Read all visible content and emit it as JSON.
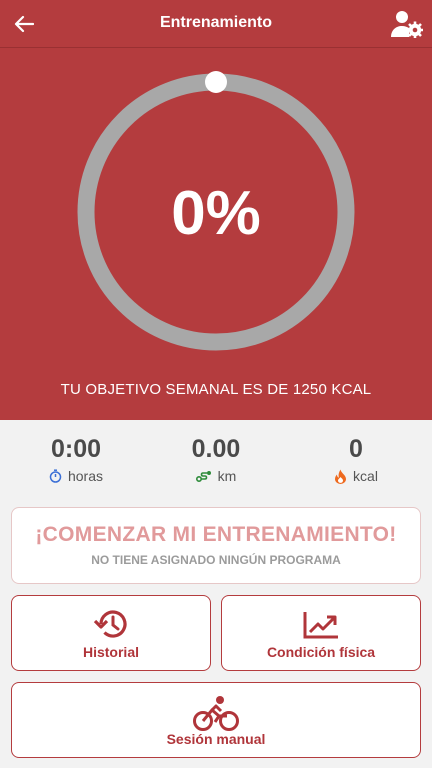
{
  "header": {
    "title": "Entrenamiento"
  },
  "progress": {
    "percent_label": "0%",
    "fraction": 0.0
  },
  "goal_text": "TU OBJETIVO SEMANAL ES DE 1250 KCAL",
  "stats": [
    {
      "value": "0:00",
      "unit": "horas",
      "icon": "stopwatch-icon"
    },
    {
      "value": "0.00",
      "unit": "km",
      "icon": "route-icon"
    },
    {
      "value": "0",
      "unit": "kcal",
      "icon": "flame-icon"
    }
  ],
  "cta": {
    "title": "¡COMENZAR MI ENTRENAMIENTO!",
    "subtitle": "NO TIENE ASIGNADO NINGÚN PROGRAMA"
  },
  "cards": {
    "history": {
      "label": "Historial",
      "icon": "history-icon"
    },
    "fitness": {
      "label": "Condición física",
      "icon": "trend-up-icon"
    },
    "manual": {
      "label": "Sesión manual",
      "icon": "cyclist-icon"
    }
  },
  "colors": {
    "brand": "#b43c3e",
    "ring": "#a8a8a8",
    "cta_text": "#e19a9b"
  }
}
